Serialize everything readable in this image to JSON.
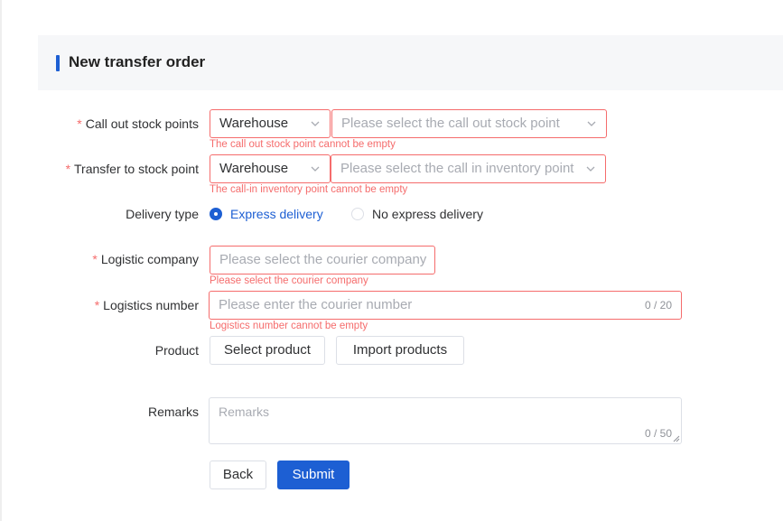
{
  "header": {
    "title": "New transfer order"
  },
  "form": {
    "call_out": {
      "label": "Call out stock points",
      "type_value": "Warehouse",
      "point_placeholder": "Please select the call out stock point",
      "error": "The call out stock point cannot be empty"
    },
    "transfer_to": {
      "label": "Transfer to stock point",
      "type_value": "Warehouse",
      "point_placeholder": "Please select the call in inventory point",
      "error": "The call-in inventory point cannot be empty"
    },
    "delivery": {
      "label": "Delivery type",
      "options": [
        "Express delivery",
        "No express delivery"
      ],
      "selected": "Express delivery"
    },
    "logistic_company": {
      "label": "Logistic company",
      "placeholder": "Please select the courier company",
      "error": "Please select the courier company"
    },
    "logistics_number": {
      "label": "Logistics number",
      "placeholder": "Please enter the courier number",
      "count": "0 / 20",
      "error": "Logistics number cannot be empty"
    },
    "product": {
      "label": "Product",
      "select_label": "Select product",
      "import_label": "Import products"
    },
    "remarks": {
      "label": "Remarks",
      "placeholder": "Remarks",
      "count": "0 / 50"
    },
    "required_mark": "*"
  },
  "actions": {
    "back_label": "Back",
    "submit_label": "Submit"
  },
  "colors": {
    "primary": "#1d5fd3",
    "error": "#f56c6c",
    "border": "#dcdfe6",
    "placeholder": "#a8abb2"
  },
  "icons": [
    "chevron-down-icon",
    "radio-checked-icon",
    "radio-unchecked-icon",
    "resize-handle-icon"
  ]
}
